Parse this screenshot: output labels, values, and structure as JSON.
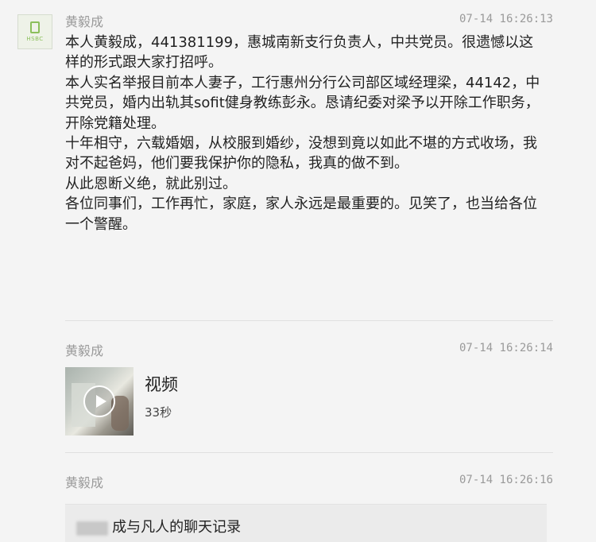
{
  "messages": [
    {
      "sender": "黄毅成",
      "time": "07-14 16:26:13",
      "lines": [
        "本人黄毅成，441381199，惠城南新支行负责人，中共党员。很遗憾以这样的形式跟大家打招呼。",
        "本人实名举报目前本人妻子，工行惠州分行公司部区域经理梁，44142，中共党员，婚内出轨其sofit健身教练彭永。恳请纪委对梁予以开除工作职务，开除党籍处理。",
        "十年相守，六载婚姻，从校服到婚纱，没想到竟以如此不堪的方式收场，我对不起爸妈，他们要我保护你的隐私，我真的做不到。",
        "从此恩断义绝，就此别过。",
        "各位同事们，工作再忙，家庭，家人永远是最重要的。见笑了，也当给各位一个警醒。"
      ]
    },
    {
      "sender": "黄毅成",
      "time": "07-14 16:26:14",
      "video": {
        "title": "视频",
        "duration": "33秒"
      }
    },
    {
      "sender": "黄毅成",
      "time": "07-14 16:26:16",
      "record_title": "成与凡人的聊天记录"
    }
  ],
  "avatar_tag": "HSBC",
  "icons": [
    "document-icon",
    "play-icon"
  ],
  "colors": {
    "meta_text": "#9a9a9a",
    "background": "#f4f4f4",
    "avatar_accent": "#8bbf5c"
  }
}
